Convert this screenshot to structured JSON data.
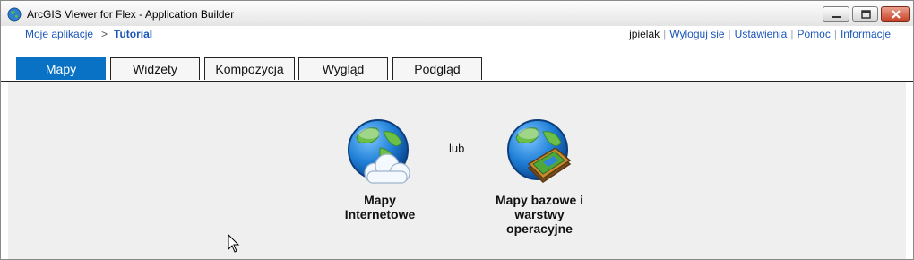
{
  "window": {
    "title": "ArcGIS Viewer for Flex - Application Builder",
    "icon": "globe-icon",
    "controls": [
      "minimize-icon",
      "maximize-icon",
      "close-icon"
    ]
  },
  "nav": {
    "breadcrumb_link": "Moje aplikacje",
    "breadcrumb_separator": ">",
    "breadcrumb_current": "Tutorial",
    "username": "jpielak",
    "links": {
      "logout": "Wyloguj sie",
      "settings": "Ustawienia",
      "help": "Pomoc",
      "info": "Informacje"
    },
    "link_separator": "|"
  },
  "tabs": [
    {
      "label": "Mapy",
      "active": true
    },
    {
      "label": "Widżety",
      "active": false
    },
    {
      "label": "Kompozycja",
      "active": false
    },
    {
      "label": "Wygląd",
      "active": false
    },
    {
      "label": "Podgląd",
      "active": false
    }
  ],
  "maps_panel": {
    "option_web": {
      "label_line1": "Mapy",
      "label_line2": "Internetowe",
      "icon": "globe-cloud-icon"
    },
    "or_text": "lub",
    "option_base": {
      "label_line1": "Mapy bazowe i",
      "label_line2": "warstwy",
      "label_line3": "operacyjne",
      "icon": "globe-layers-icon"
    }
  },
  "colors": {
    "tab_active_bg": "#0a72c4",
    "link": "#1a56b8",
    "panel_bg": "#efefef"
  }
}
